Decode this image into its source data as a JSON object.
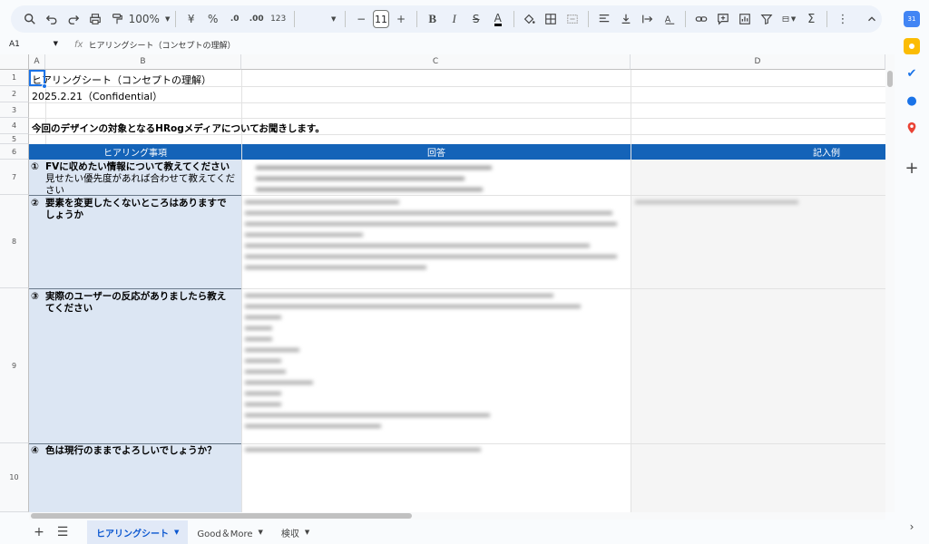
{
  "toolbar": {
    "zoom": "100%",
    "currency": "¥",
    "percent": "%",
    "dec_decrease": ".0",
    "dec_increase": ".00",
    "number_format": "123",
    "font_size": "11",
    "minus": "−",
    "plus": "+"
  },
  "formula": {
    "cell_ref": "A1",
    "fx": "fx",
    "content": "ヒアリングシート（コンセプトの理解）"
  },
  "columns": [
    "A",
    "B",
    "C",
    "D"
  ],
  "rows": [
    "1",
    "2",
    "3",
    "4",
    "5",
    "6",
    "7",
    "8",
    "9",
    "10"
  ],
  "sheet": {
    "title": "ヒアリングシート（コンセプトの理解）",
    "date": "2025.2.21（Confidential）",
    "intro": "今回のデザインの対象となるHRogメディアについてお聞きします。",
    "headers": {
      "question": "ヒアリング事項",
      "answer": "回答",
      "example": "記入例"
    },
    "questions": [
      {
        "num": "①",
        "text": "FVに収めたい情報について教えてください",
        "sub": "見せたい優先度があれば合わせて教えてください"
      },
      {
        "num": "②",
        "text": "要素を変更したくないところはありますでしょうか",
        "sub": ""
      },
      {
        "num": "③",
        "text": "実際のユーザーの反応がありましたら教えてください",
        "sub": ""
      },
      {
        "num": "④",
        "text": "色は現行のままでよろしいでしょうか？",
        "sub": ""
      }
    ]
  },
  "tabs": {
    "sheet1": "ヒアリングシート",
    "sheet2": "Good＆More",
    "sheet3": "検収"
  },
  "colors": {
    "header_band": "#1463b8",
    "question_col": "#dce6f3",
    "selection": "#1a73e8"
  }
}
